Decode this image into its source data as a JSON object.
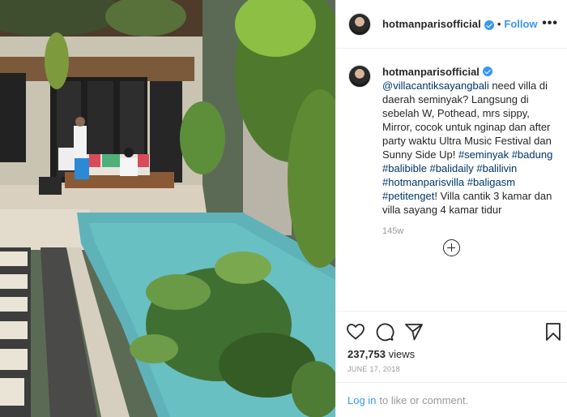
{
  "post": {
    "username": "hotmanparisofficial",
    "follow_label": "Follow",
    "separator": "•",
    "more_label": "•••"
  },
  "caption": {
    "username": "hotmanparisofficial",
    "mention": "@villacantiksayangbali",
    "text_1": " need villa di daerah seminyak? Langsung di sebelah W, Pothead, mrs sippy, Mirror, cocok untuk nginap dan after party waktu Ultra Music Festival dan Sunny Side Up! ",
    "hashtags_1": "#seminyak #badung #balibible #balidaily #balilivin #hotmanparisvilla #baligasm #petitenget",
    "text_2": "! Villa cantik 3 kamar dan villa sayang 4 kamar tidur",
    "time_ago": "145w"
  },
  "icons": {
    "like": "heart-icon",
    "comment": "comment-icon",
    "share": "share-icon",
    "save": "bookmark-icon",
    "load_more": "plus-circle-icon"
  },
  "stats": {
    "views_count": "237,753",
    "views_label": " views",
    "date": "June 17, 2018"
  },
  "login_bar": {
    "login_link": "Log in",
    "rest": "to like or comment."
  },
  "colors": {
    "accent": "#3897f0",
    "text": "#262626",
    "muted": "#999999",
    "hashtag": "#003569",
    "border": "#efefef"
  }
}
